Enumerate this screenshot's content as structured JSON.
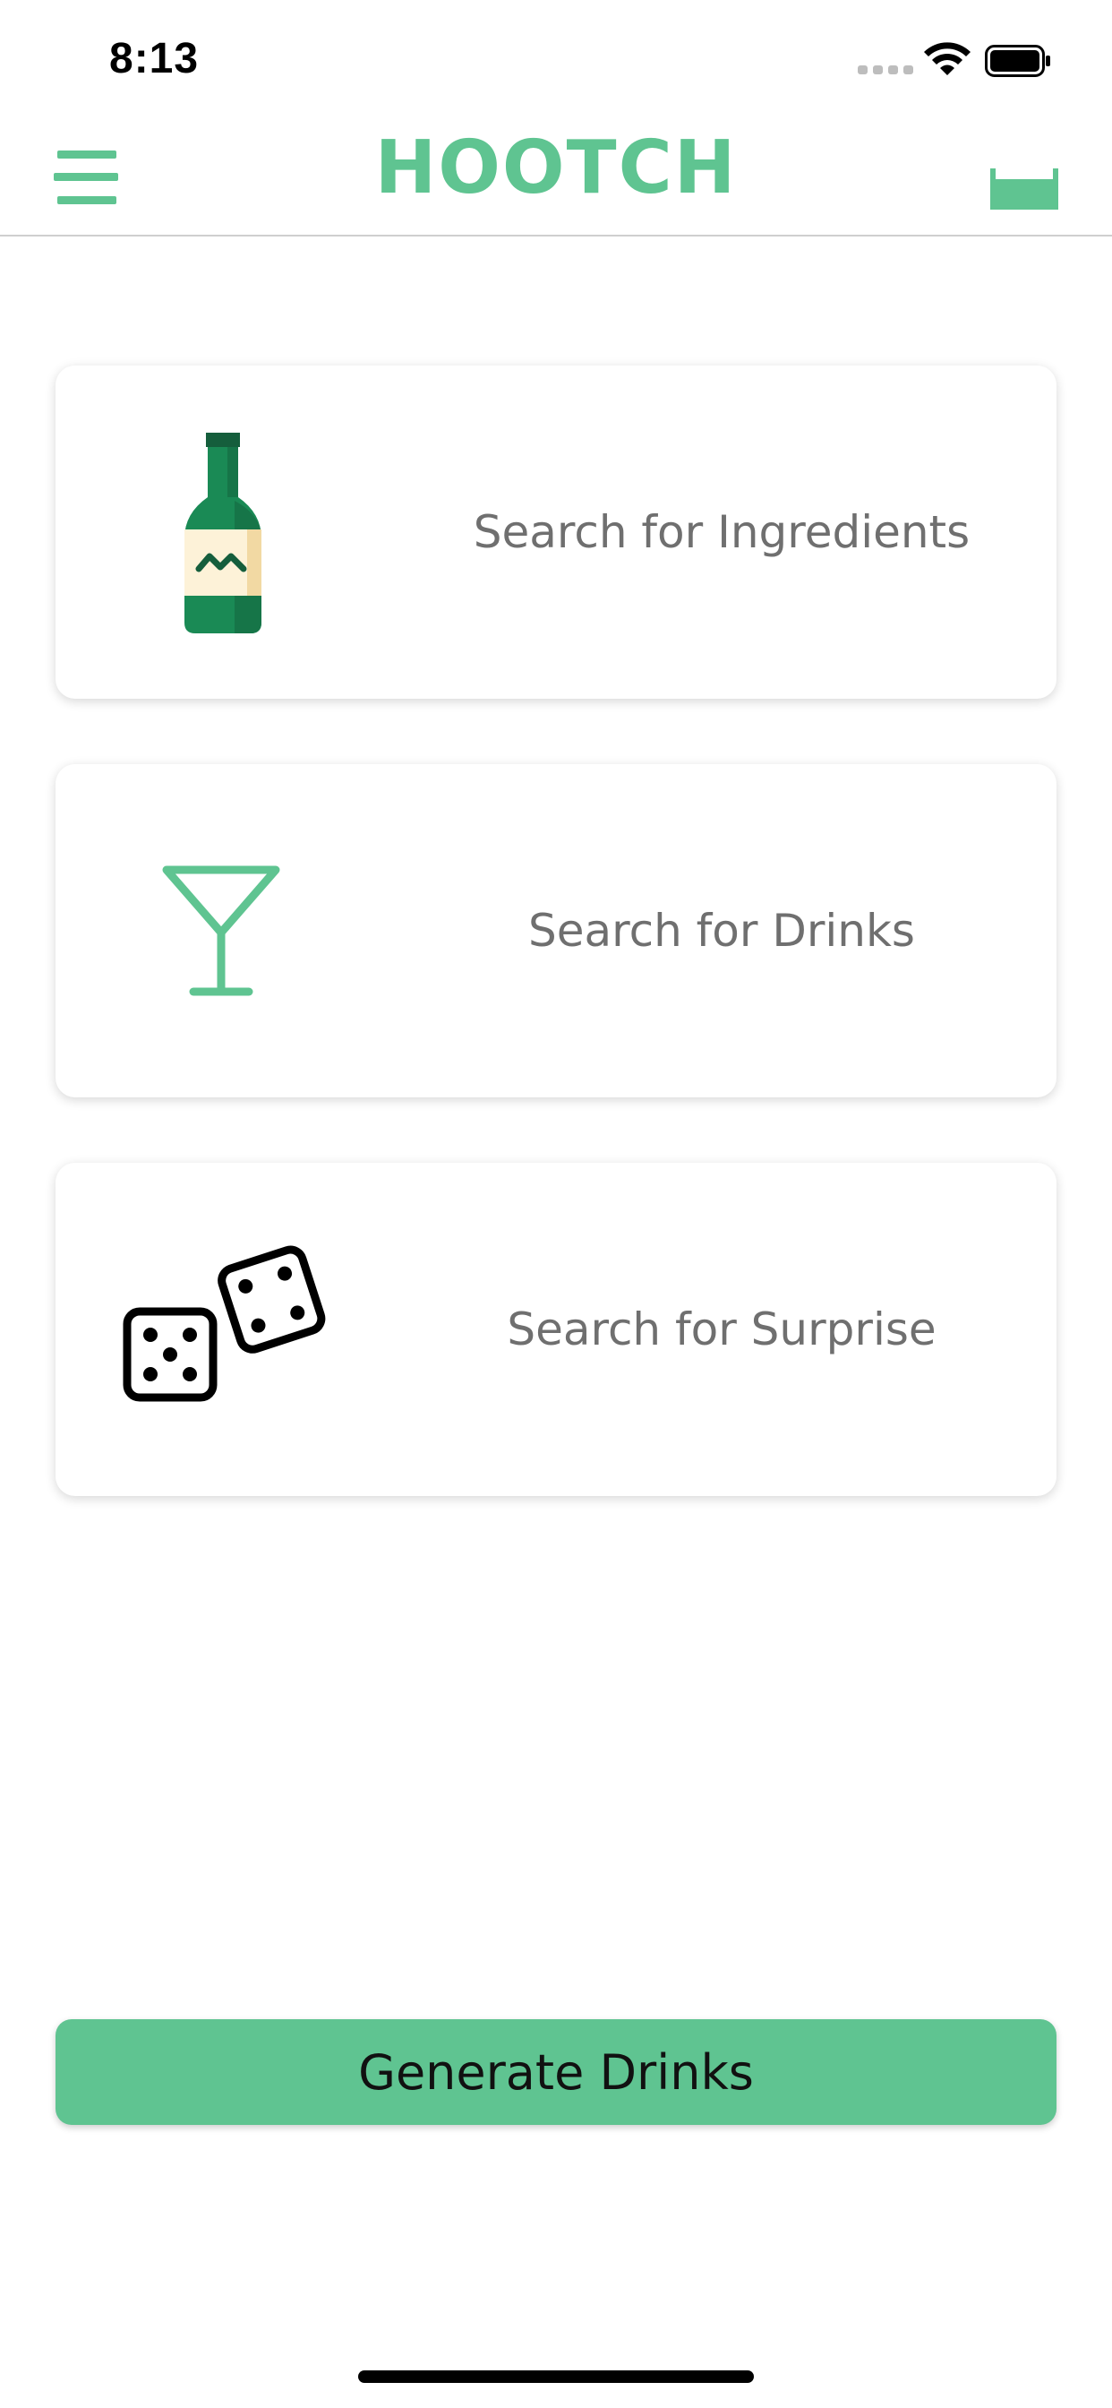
{
  "status_bar": {
    "time": "8:13"
  },
  "header": {
    "title": "HOOTCH",
    "menu_icon": "hamburger-menu-icon",
    "cart_icon": "cart-icon"
  },
  "cards": [
    {
      "label": "Search for Ingredients",
      "icon": "bottle-icon"
    },
    {
      "label": "Search for Drinks",
      "icon": "cocktail-glass-icon"
    },
    {
      "label": "Search for Surprise",
      "icon": "dice-icon"
    }
  ],
  "generate_button": {
    "label": "Generate Drinks"
  },
  "colors": {
    "accent": "#5fc491",
    "text_muted": "#6f6f6f",
    "bottle_dark": "#1a7a4c"
  }
}
